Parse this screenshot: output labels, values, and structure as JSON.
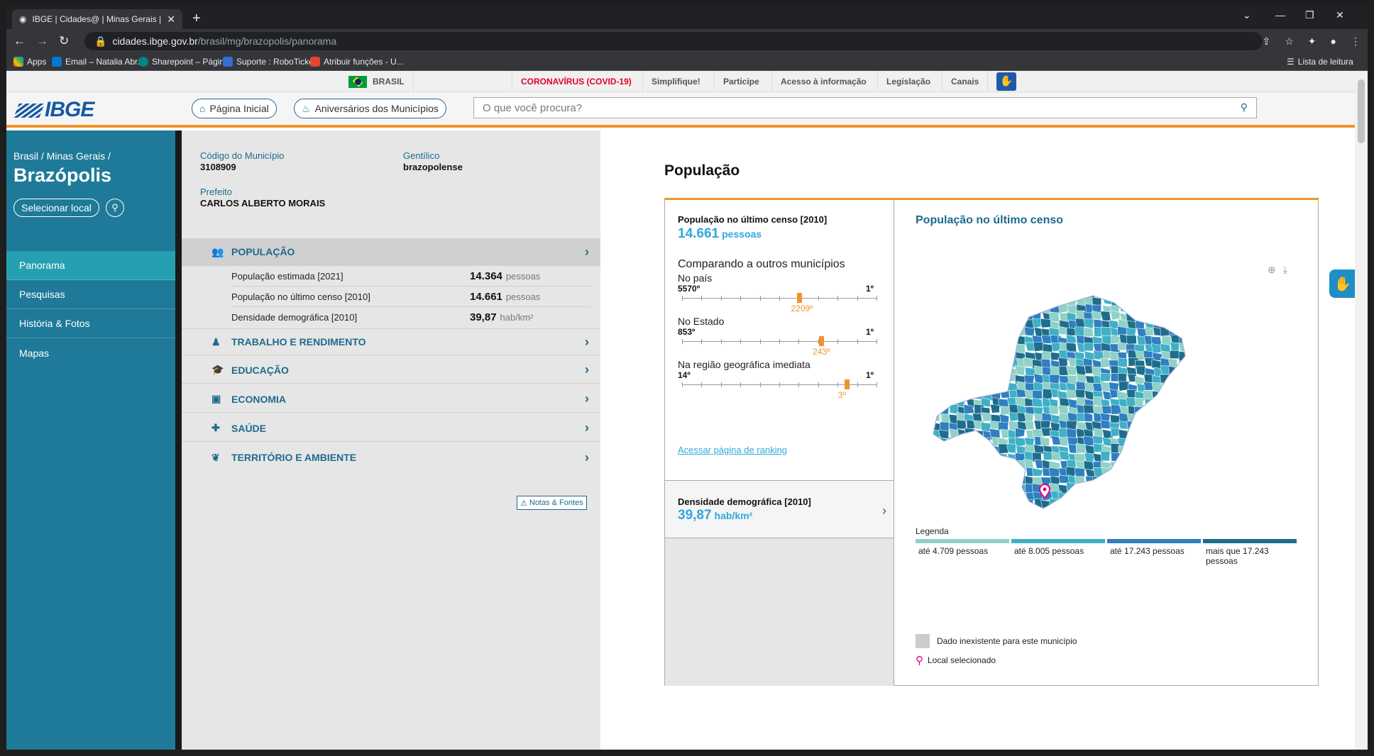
{
  "browser": {
    "tab_title": "IBGE | Cidades@ | Minas Gerais |",
    "url_host": "cidades.ibge.gov.br",
    "url_path": "/brasil/mg/brazopolis/panorama",
    "bookmarks": [
      "Apps",
      "Email – Natalia Abr...",
      "Sharepoint – Págin...",
      "Suporte : RoboTicket",
      "Atribuir funções - U..."
    ],
    "reading_list": "Lista de leitura"
  },
  "toplinks": {
    "brasil": "BRASIL",
    "covid": "CORONAVÍRUS (COVID-19)",
    "simplifique": "Simplifique!",
    "participe": "Participe",
    "acesso": "Acesso à informação",
    "legislacao": "Legislação",
    "canais": "Canais"
  },
  "header": {
    "logo": "IBGE",
    "home": "Página Inicial",
    "aniversarios": "Aniversários dos Municípios",
    "search_placeholder": "O que você procura?"
  },
  "sidebar": {
    "breadcrumb": "Brasil / Minas Gerais /",
    "city": "Brazópolis",
    "select_local": "Selecionar local",
    "nav": [
      "Panorama",
      "Pesquisas",
      "História & Fotos",
      "Mapas"
    ]
  },
  "info": {
    "codigo_label": "Código do Município",
    "codigo": "3108909",
    "gentilico_label": "Gentílico",
    "gentilico": "brazopolense",
    "prefeito_label": "Prefeito",
    "prefeito": "CARLOS ALBERTO MORAIS"
  },
  "sections": {
    "populacao": "POPULAÇÃO",
    "trabalho": "TRABALHO E RENDIMENTO",
    "educacao": "EDUCAÇÃO",
    "economia": "ECONOMIA",
    "saude": "SAÚDE",
    "territorio": "TERRITÓRIO E AMBIENTE"
  },
  "pop_rows": [
    {
      "label": "População estimada [2021]",
      "value": "14.364",
      "unit": "pessoas"
    },
    {
      "label": "População no último censo [2010]",
      "value": "14.661",
      "unit": "pessoas"
    },
    {
      "label": "Densidade demográfica [2010]",
      "value": "39,87",
      "unit": "hab/km²"
    }
  ],
  "notes": "Notas & Fontes",
  "content": {
    "title": "População",
    "censo_label": "População no último censo [2010]",
    "censo_value": "14.661",
    "censo_unit": "pessoas",
    "comparando": "Comparando a outros municípios",
    "rankings": [
      {
        "label": "No país",
        "low": "5570º",
        "high": "1º",
        "value": "2209º",
        "fraction": 0.604
      },
      {
        "label": "No Estado",
        "low": "853º",
        "high": "1º",
        "value": "243º",
        "fraction": 0.716
      },
      {
        "label": "Na região geográfica imediata",
        "low": "14º",
        "high": "1º",
        "value": "3º",
        "fraction": 0.846
      }
    ],
    "ranking_link": "Acessar página de ranking",
    "dens_label": "Densidade demográfica [2010]",
    "dens_value": "39,87",
    "dens_unit": "hab/km²",
    "map_title": "População no último censo",
    "legend_title": "Legenda",
    "legend": [
      {
        "label": "até 4.709 pessoas",
        "color": "#8fd1c6"
      },
      {
        "label": "até 8.005 pessoas",
        "color": "#3fb0c6"
      },
      {
        "label": "até 17.243 pessoas",
        "color": "#2f7fc1"
      },
      {
        "label": "mais que 17.243 pessoas",
        "color": "#1f6d8c"
      }
    ],
    "nodata": "Dado inexistente para este município",
    "local_sel": "Local selecionado"
  },
  "colors": {
    "accent": "#f0942b",
    "sidebar": "#1f7a99",
    "link": "#2fa8dc"
  }
}
